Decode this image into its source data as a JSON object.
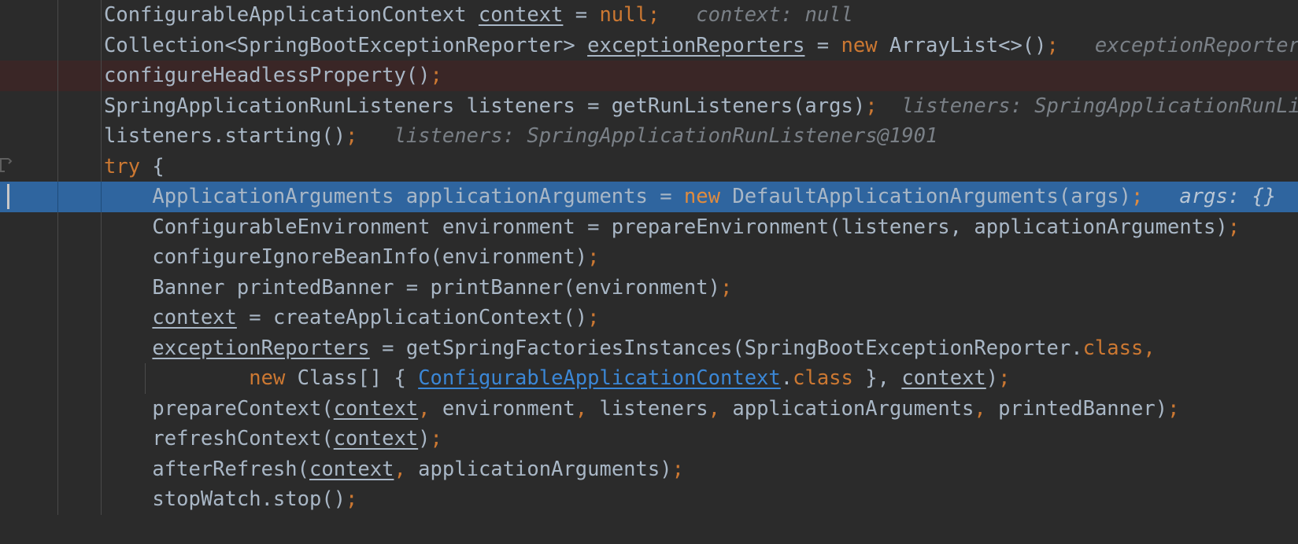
{
  "editor": {
    "app": "IntelliJ IDEA",
    "view": "java-source-debugger",
    "file_context": "SpringApplication.run",
    "background_color": "#2b2b2b",
    "default_text_color": "#a9b7c6",
    "keyword_color": "#cc7832",
    "hint_color": "#7a8087",
    "link_color": "#3b87d6",
    "executed_line_color": "#3a2626",
    "selected_line_color": "#2f659f",
    "gutter_divider_color": "#4a4a4a",
    "caret_color": "#c8c8c8"
  },
  "lines": [
    {
      "id": "line-context-decl",
      "state": "normal",
      "segments": [
        {
          "t": "ConfigurableApplicationContext ",
          "c": "ident"
        },
        {
          "t": "context",
          "c": "under"
        },
        {
          "t": " = ",
          "c": "ident"
        },
        {
          "t": "null",
          "c": "kw"
        },
        {
          "t": ";",
          "c": "punc"
        },
        {
          "t": "   ",
          "c": "ident"
        },
        {
          "t": "context: null",
          "c": "hint"
        }
      ]
    },
    {
      "id": "line-exception-reporters-decl",
      "state": "normal",
      "segments": [
        {
          "t": "Collection<SpringBootExceptionReporter> ",
          "c": "ident"
        },
        {
          "t": "exceptionReporters",
          "c": "under"
        },
        {
          "t": " = ",
          "c": "ident"
        },
        {
          "t": "new",
          "c": "kw"
        },
        {
          "t": " ArrayList<>()",
          "c": "ident"
        },
        {
          "t": ";",
          "c": "punc"
        },
        {
          "t": "   ",
          "c": "ident"
        },
        {
          "t": "exceptionReporters:",
          "c": "hint"
        }
      ]
    },
    {
      "id": "line-configure-headless",
      "state": "executed",
      "segments": [
        {
          "t": "configureHeadlessProperty()",
          "c": "ident"
        },
        {
          "t": ";",
          "c": "punc"
        }
      ]
    },
    {
      "id": "line-run-listeners",
      "state": "normal",
      "segments": [
        {
          "t": "SpringApplicationRunListeners listeners = getRunListeners(args)",
          "c": "ident"
        },
        {
          "t": ";",
          "c": "punc"
        },
        {
          "t": "  ",
          "c": "ident"
        },
        {
          "t": "listeners: SpringApplicationRunList",
          "c": "hint"
        }
      ]
    },
    {
      "id": "line-listeners-starting",
      "state": "normal",
      "segments": [
        {
          "t": "listeners.starting()",
          "c": "ident"
        },
        {
          "t": ";",
          "c": "punc"
        },
        {
          "t": "   ",
          "c": "ident"
        },
        {
          "t": "listeners: SpringApplicationRunListeners@1901",
          "c": "hint"
        }
      ]
    },
    {
      "id": "line-try",
      "state": "normal",
      "fold": true,
      "segments": [
        {
          "t": "try",
          "c": "kw"
        },
        {
          "t": " {",
          "c": "ident"
        }
      ]
    },
    {
      "id": "line-application-arguments",
      "state": "selected",
      "indent": 4,
      "segments": [
        {
          "t": "    ApplicationArguments applicationArguments = ",
          "c": "ident"
        },
        {
          "t": "new",
          "c": "kw"
        },
        {
          "t": " DefaultApplicationArguments(args)",
          "c": "ident"
        },
        {
          "t": ";",
          "c": "punc"
        },
        {
          "t": "   ",
          "c": "ident"
        },
        {
          "t": "args: {}",
          "c": "hint"
        }
      ]
    },
    {
      "id": "line-prepare-environment",
      "state": "normal",
      "segments": [
        {
          "t": "    ConfigurableEnvironment environment = prepareEnvironment(listeners, applicationArguments)",
          "c": "ident"
        },
        {
          "t": ";",
          "c": "punc"
        }
      ]
    },
    {
      "id": "line-configure-ignore-bean-info",
      "state": "normal",
      "segments": [
        {
          "t": "    configureIgnoreBeanInfo(environment)",
          "c": "ident"
        },
        {
          "t": ";",
          "c": "punc"
        }
      ]
    },
    {
      "id": "line-print-banner",
      "state": "normal",
      "segments": [
        {
          "t": "    Banner printedBanner = printBanner(environment)",
          "c": "ident"
        },
        {
          "t": ";",
          "c": "punc"
        }
      ]
    },
    {
      "id": "line-create-application-context",
      "state": "normal",
      "segments": [
        {
          "t": "    ",
          "c": "ident"
        },
        {
          "t": "context",
          "c": "under"
        },
        {
          "t": " = createApplicationContext()",
          "c": "ident"
        },
        {
          "t": ";",
          "c": "punc"
        }
      ]
    },
    {
      "id": "line-get-spring-factories-instances",
      "state": "normal",
      "segments": [
        {
          "t": "    ",
          "c": "ident"
        },
        {
          "t": "exceptionReporters",
          "c": "under"
        },
        {
          "t": " = getSpringFactoriesInstances(SpringBootExceptionReporter.",
          "c": "ident"
        },
        {
          "t": "class",
          "c": "kw"
        },
        {
          "t": ",",
          "c": "punc"
        }
      ]
    },
    {
      "id": "line-new-class-array",
      "state": "normal",
      "guide": true,
      "segments": [
        {
          "t": "            ",
          "c": "ident"
        },
        {
          "t": "new",
          "c": "kw"
        },
        {
          "t": " Class[] { ",
          "c": "ident"
        },
        {
          "t": "ConfigurableApplicationContext",
          "c": "link"
        },
        {
          "t": ".",
          "c": "ident"
        },
        {
          "t": "class",
          "c": "kw"
        },
        {
          "t": " }, ",
          "c": "ident"
        },
        {
          "t": "context",
          "c": "under"
        },
        {
          "t": ")",
          "c": "ident"
        },
        {
          "t": ";",
          "c": "punc"
        }
      ]
    },
    {
      "id": "line-prepare-context",
      "state": "normal",
      "segments": [
        {
          "t": "    prepareContext(",
          "c": "ident"
        },
        {
          "t": "context",
          "c": "under"
        },
        {
          "t": ",",
          "c": "punc"
        },
        {
          "t": " environment",
          "c": "ident"
        },
        {
          "t": ",",
          "c": "punc"
        },
        {
          "t": " listeners",
          "c": "ident"
        },
        {
          "t": ",",
          "c": "punc"
        },
        {
          "t": " applicationArguments",
          "c": "ident"
        },
        {
          "t": ",",
          "c": "punc"
        },
        {
          "t": " printedBanner)",
          "c": "ident"
        },
        {
          "t": ";",
          "c": "punc"
        }
      ]
    },
    {
      "id": "line-refresh-context",
      "state": "normal",
      "segments": [
        {
          "t": "    refreshContext(",
          "c": "ident"
        },
        {
          "t": "context",
          "c": "under"
        },
        {
          "t": ")",
          "c": "ident"
        },
        {
          "t": ";",
          "c": "punc"
        }
      ]
    },
    {
      "id": "line-after-refresh",
      "state": "normal",
      "segments": [
        {
          "t": "    afterRefresh(",
          "c": "ident"
        },
        {
          "t": "context",
          "c": "under"
        },
        {
          "t": ",",
          "c": "punc"
        },
        {
          "t": " applicationArguments)",
          "c": "ident"
        },
        {
          "t": ";",
          "c": "punc"
        }
      ]
    },
    {
      "id": "line-stopwatch-stop",
      "state": "normal",
      "segments": [
        {
          "t": "    stopWatch.stop()",
          "c": "ident"
        },
        {
          "t": ";",
          "c": "punc"
        }
      ]
    }
  ]
}
